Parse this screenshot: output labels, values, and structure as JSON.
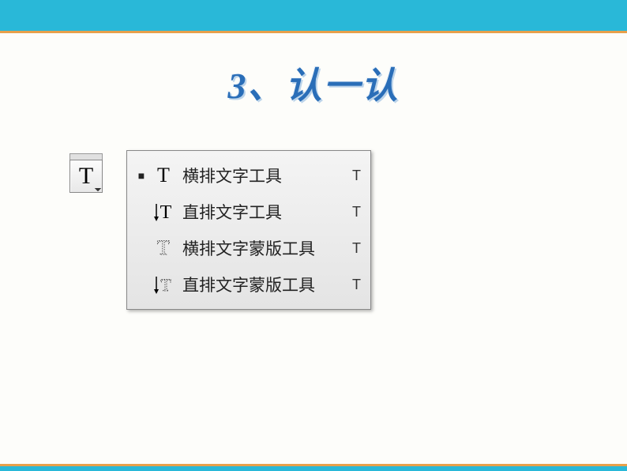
{
  "title": "3、认一认",
  "tool_button": {
    "letter": "T"
  },
  "menu": {
    "items": [
      {
        "label": "横排文字工具",
        "shortcut": "T",
        "active": true,
        "icon": "horizontal-type"
      },
      {
        "label": "直排文字工具",
        "shortcut": "T",
        "active": false,
        "icon": "vertical-type"
      },
      {
        "label": "横排文字蒙版工具",
        "shortcut": "T",
        "active": false,
        "icon": "horizontal-type-mask"
      },
      {
        "label": "直排文字蒙版工具",
        "shortcut": "T",
        "active": false,
        "icon": "vertical-type-mask"
      }
    ]
  }
}
